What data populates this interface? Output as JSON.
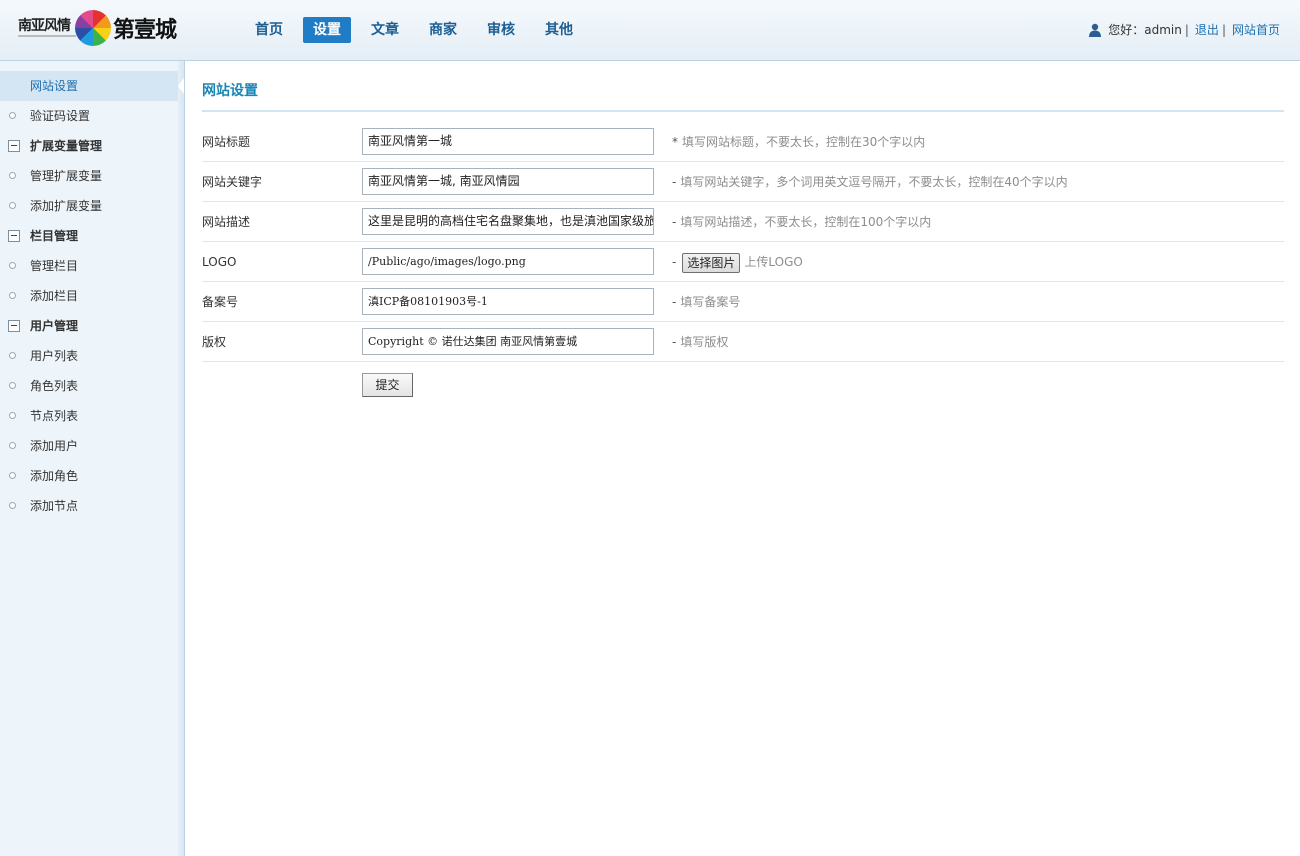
{
  "header": {
    "logo_left": "南亚风情",
    "logo_right": "第壹城",
    "nav": [
      "首页",
      "设置",
      "文章",
      "商家",
      "审核",
      "其他"
    ],
    "nav_active_index": 1,
    "greeting": "您好：admin",
    "logout": "退出",
    "home_link": "网站首页",
    "separator": "|"
  },
  "sidebar": {
    "items": [
      {
        "label": "网站设置",
        "type": "current"
      },
      {
        "label": "验证码设置",
        "type": "item"
      },
      {
        "label": "扩展变量管理",
        "type": "group"
      },
      {
        "label": "管理扩展变量",
        "type": "item"
      },
      {
        "label": "添加扩展变量",
        "type": "item"
      },
      {
        "label": "栏目管理",
        "type": "group"
      },
      {
        "label": "管理栏目",
        "type": "item"
      },
      {
        "label": "添加栏目",
        "type": "item"
      },
      {
        "label": "用户管理",
        "type": "group"
      },
      {
        "label": "用户列表",
        "type": "item"
      },
      {
        "label": "角色列表",
        "type": "item"
      },
      {
        "label": "节点列表",
        "type": "item"
      },
      {
        "label": "添加用户",
        "type": "item"
      },
      {
        "label": "添加角色",
        "type": "item"
      },
      {
        "label": "添加节点",
        "type": "item"
      }
    ]
  },
  "main": {
    "title": "网站设置",
    "fields": {
      "site_title": {
        "label": "网站标题",
        "value": "南亚风情第一城",
        "hint_prefix": "*",
        "hint": "填写网站标题，不要太长，控制在30个字以内"
      },
      "keywords": {
        "label": "网站关键字",
        "value": "南亚风情第一城, 南亚风情园",
        "hint_prefix": "-",
        "hint": "填写网站关键字，多个词用英文逗号隔开，不要太长，控制在40个字以内"
      },
      "description": {
        "label": "网站描述",
        "value": "这里是昆明的高档住宅名盘聚集地，也是滇池国家级旅",
        "hint_prefix": "-",
        "hint": "填写网站描述，不要太长，控制在100个字以内"
      },
      "logo": {
        "label": "LOGO",
        "value": "/Public/ago/images/logo.png",
        "hint_prefix": "-",
        "button": "选择图片",
        "hint": "上传LOGO"
      },
      "icp": {
        "label": "备案号",
        "value": "滇ICP备08101903号-1",
        "hint_prefix": "-",
        "hint": "填写备案号"
      },
      "copyright": {
        "label": "版权",
        "value": "Copyright © 诺仕达集团  南亚风情第壹城",
        "hint_prefix": "-",
        "hint": "填写版权"
      }
    },
    "submit": "提交"
  },
  "colors": {
    "accent": "#1f7cc5",
    "title": "#1a86b7",
    "sidebar_bg": "#eef5fa"
  }
}
